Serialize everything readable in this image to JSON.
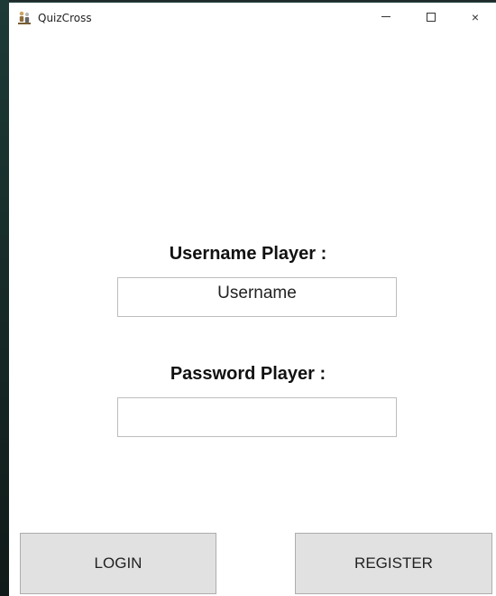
{
  "window": {
    "title": "QuizCross",
    "controls": {
      "minimize": "minimize",
      "maximize": "maximize",
      "close": "×"
    }
  },
  "form": {
    "username_label": "Username Player :",
    "username_value": "Username",
    "password_label": "Password Player :",
    "password_value": ""
  },
  "buttons": {
    "login": "LOGIN",
    "register": "REGISTER"
  },
  "icons": {
    "app": "quizcross-app-icon",
    "minimize": "minimize-icon",
    "maximize": "maximize-icon",
    "close": "close-icon"
  }
}
